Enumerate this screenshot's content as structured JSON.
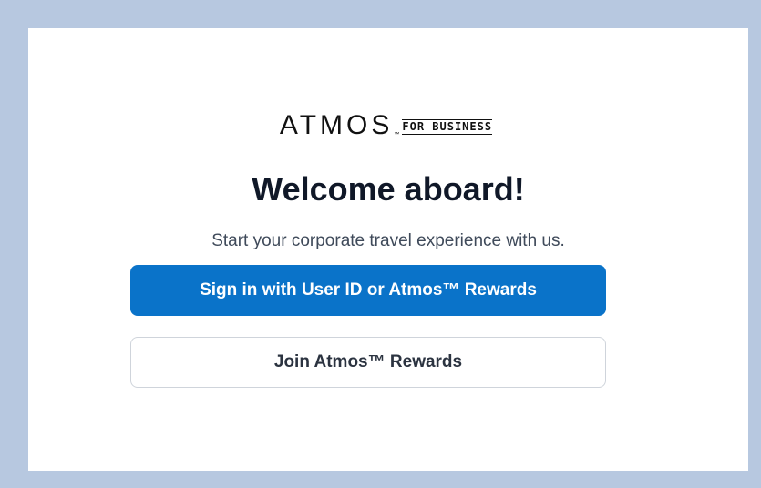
{
  "logo": {
    "main": "ATMOS",
    "tm": "™",
    "sub": "FOR BUSINESS"
  },
  "title": "Welcome aboard!",
  "subtitle": "Start your corporate travel experience with us.",
  "buttons": {
    "sign_in": "Sign in with User ID or Atmos™ Rewards",
    "join": "Join Atmos™ Rewards"
  },
  "colors": {
    "background": "#b7c8e0",
    "card": "#ffffff",
    "primary": "#0a73c9",
    "title_text": "#101828",
    "secondary_border": "#cfd4db"
  }
}
